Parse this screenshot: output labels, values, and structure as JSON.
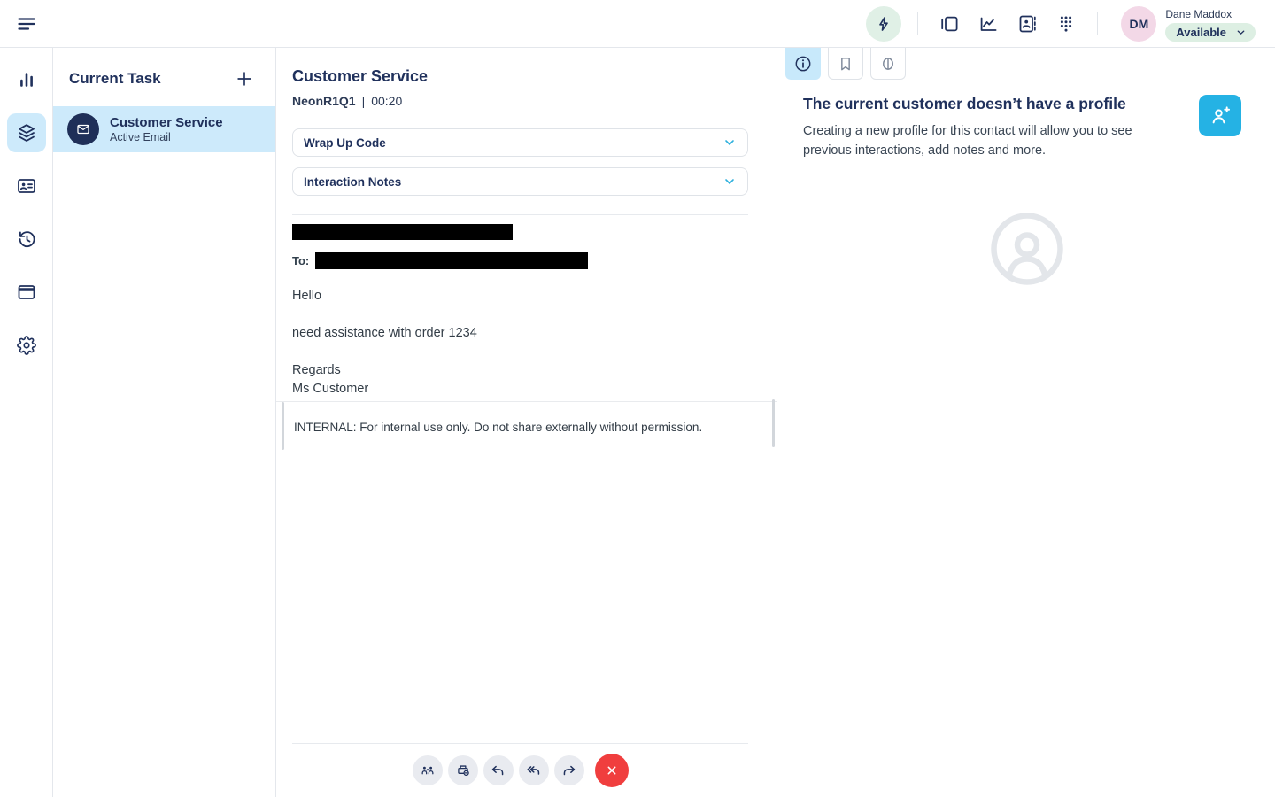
{
  "header": {
    "user": {
      "initials": "DM",
      "name": "Dane Maddox",
      "status": "Available"
    },
    "icons": [
      "hamburger-icon",
      "lightning-icon",
      "panels-icon",
      "performance-chart-icon",
      "contact-book-icon",
      "dialpad-icon",
      "chevron-down-icon"
    ]
  },
  "sidebar": {
    "items": [
      {
        "name": "performance",
        "icon": "bar-chart-icon",
        "active": false
      },
      {
        "name": "tasks",
        "icon": "layers-icon",
        "active": true
      },
      {
        "name": "contacts",
        "icon": "contact-card-icon",
        "active": false
      },
      {
        "name": "history",
        "icon": "history-icon",
        "active": false
      },
      {
        "name": "windows",
        "icon": "window-icon",
        "active": false
      },
      {
        "name": "settings",
        "icon": "gear-icon",
        "active": false
      }
    ]
  },
  "task_panel": {
    "title": "Current Task",
    "add_icon": "plus-icon",
    "task": {
      "title": "Customer Service",
      "subtitle": "Active Email",
      "icon": "envelope-icon"
    }
  },
  "main": {
    "title": "Customer Service",
    "queue": "NeonR1Q1",
    "meta_divider": "|",
    "timer": "00:20",
    "accordions": [
      {
        "label": "Wrap Up Code",
        "icon": "chevron-down-icon"
      },
      {
        "label": "Interaction Notes",
        "icon": "chevron-down-icon"
      }
    ],
    "email": {
      "from_redacted": true,
      "to_label": "To:",
      "to_redacted": true,
      "greeting": "Hello",
      "body": "need assistance with order 1234",
      "signoff": "Regards",
      "signature": "Ms Customer",
      "internal_note": "INTERNAL: For internal use only. Do not share externally without permission."
    },
    "toolbar_icons": [
      "transfer-people-icon",
      "printer-icon",
      "reply-icon",
      "reply-all-icon",
      "forward-icon",
      "close-x-icon"
    ]
  },
  "right_panel": {
    "tabs": [
      "info-icon",
      "bookmark-icon",
      "brain-icon"
    ],
    "heading": "The current customer doesn’t have a profile",
    "description": "Creating a new profile for this contact will allow you to see previous interactions, add notes and more.",
    "add_user_icon": "person-add-icon",
    "placeholder_icon": "profile-placeholder-icon"
  },
  "colors": {
    "navy": "#20315c",
    "accent_cyan": "#25b2e4",
    "chevron_teal": "#2fb0dd",
    "highlight_blue": "#cdeafb",
    "status_green_bg": "#ddefe3",
    "avatar_pink_bg": "#f3d8e7",
    "quick_action_green_bg": "#e0f0e6",
    "toolbar_gray": "#e9ebf0",
    "danger_red": "#f03e3e",
    "placeholder_gray": "#e3e6ea"
  }
}
